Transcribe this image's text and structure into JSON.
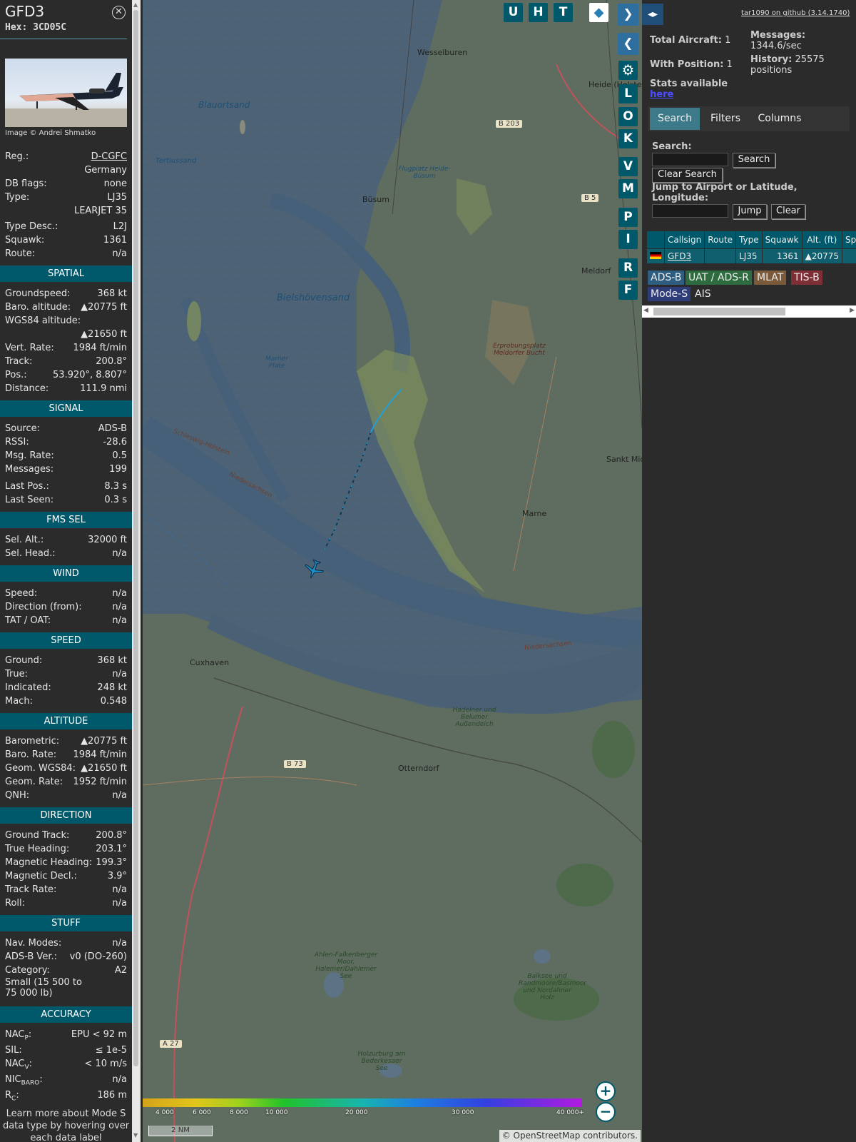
{
  "aircraft": {
    "callsign": "GFD3",
    "hex": "Hex: 3CD05C",
    "photo_credit": "Image © Andrei Shmatko",
    "reg_label": "Reg.:",
    "reg": "D-CGFC",
    "country": "Germany",
    "dbflags_label": "DB flags:",
    "dbflags": "none",
    "type_label": "Type:",
    "type": "LJ35",
    "type_name": "LEARJET 35",
    "typedesc_label": "Type Desc.:",
    "typedesc": "L2J",
    "squawk_label": "Squawk:",
    "squawk": "1361",
    "route_label": "Route:",
    "route": "n/a"
  },
  "spatial": {
    "title": "SPATIAL",
    "gs_label": "Groundspeed:",
    "gs": "368 kt",
    "baro_label": "Baro. altitude:",
    "baro": "▲20775 ft",
    "wgs_label": "WGS84 altitude:",
    "wgs": "▲21650 ft",
    "vr_label": "Vert. Rate:",
    "vr": "1984 ft/min",
    "track_label": "Track:",
    "track": "200.8°",
    "pos_label": "Pos.:",
    "pos": "53.920°, 8.807°",
    "dist_label": "Distance:",
    "dist": "111.9 nmi"
  },
  "signal": {
    "title": "SIGNAL",
    "src_label": "Source:",
    "src": "ADS-B",
    "rssi_label": "RSSI:",
    "rssi": "-28.6",
    "rate_label": "Msg. Rate:",
    "rate": "0.5",
    "msgs_label": "Messages:",
    "msgs": "199",
    "lastpos_label": "Last Pos.:",
    "lastpos": "8.3 s",
    "lastseen_label": "Last Seen:",
    "lastseen": "0.3 s"
  },
  "fms": {
    "title": "FMS SEL",
    "alt_label": "Sel. Alt.:",
    "alt": "32000 ft",
    "head_label": "Sel. Head.:",
    "head": "n/a"
  },
  "wind": {
    "title": "WIND",
    "speed_label": "Speed:",
    "speed": "n/a",
    "dir_label": "Direction (from):",
    "dir": "n/a",
    "tat_label": "TAT / OAT:",
    "tat": "n/a"
  },
  "speed": {
    "title": "SPEED",
    "ground_label": "Ground:",
    "ground": "368 kt",
    "true_label": "True:",
    "true": "n/a",
    "ind_label": "Indicated:",
    "ind": "248 kt",
    "mach_label": "Mach:",
    "mach": "0.548"
  },
  "altitude": {
    "title": "ALTITUDE",
    "baro_label": "Barometric:",
    "baro": "▲20775 ft",
    "barorate_label": "Baro. Rate:",
    "barorate": "1984 ft/min",
    "geom_label": "Geom. WGS84:",
    "geom": "▲21650 ft",
    "geomrate_label": "Geom. Rate:",
    "geomrate": "1952 ft/min",
    "qnh_label": "QNH:",
    "qnh": "n/a"
  },
  "direction": {
    "title": "DIRECTION",
    "gt_label": "Ground Track:",
    "gt": "200.8°",
    "th_label": "True Heading:",
    "th": "203.1°",
    "mh_label": "Magnetic Heading:",
    "mh": "199.3°",
    "md_label": "Magnetic Decl.:",
    "md": "3.9°",
    "tr_label": "Track Rate:",
    "tr": "n/a",
    "roll_label": "Roll:",
    "roll": "n/a"
  },
  "stuff": {
    "title": "STUFF",
    "nav_label": "Nav. Modes:",
    "nav": "n/a",
    "adsb_label": "ADS-B Ver.:",
    "adsb": "v0 (DO-260)",
    "cat_label": "Category:",
    "cat": "A2",
    "cat_desc": "Small (15 500 to 75 000 lb)"
  },
  "accuracy": {
    "title": "ACCURACY",
    "nacp_label": "NAC",
    "nacp_sub": "P",
    "nacp": "EPU < 92 m",
    "sil_label": "SIL:",
    "sil": "≤ 1e-5",
    "nacv_label": "NAC",
    "nacv_sub": "V",
    "nacv": "< 10 m/s",
    "nicbaro_label": "NIC",
    "nicbaro_sub": "BARO",
    "nicbaro": "n/a",
    "rc_label": "R",
    "rc_sub": "C",
    "rc": "186 m"
  },
  "footer_note": "Learn more about Mode S data type by hovering over each data label",
  "map": {
    "buttons_top": [
      "U",
      "H",
      "T"
    ],
    "buttons_side": [
      "L",
      "O",
      "K",
      "V",
      "M",
      "P",
      "I",
      "R",
      "F"
    ],
    "zoom_in": "+",
    "zoom_out": "−",
    "scale": "2 NM",
    "attribution_prefix": "© ",
    "attribution_link": "OpenStreetMap",
    "attribution_suffix": " contributors.",
    "legend_labels": [
      "4 000",
      "6 000",
      "8 000",
      "10 000",
      "20 000",
      "30 000",
      "40 000+"
    ],
    "places": {
      "wesselburen": "Wesselburen",
      "heide": "Heide (Holstein)",
      "blauortsand": "Blauortsand",
      "tertiussand": "Tertiussand",
      "flugplatz": "Flugplatz Heide-Büsum",
      "busum": "Büsum",
      "meldorf": "Meldorf",
      "bielshovensand": "Bielshövensand",
      "erprobung": "Erprobungsplatz Meldorfer Bucht",
      "marner_plate": "Marner Plate",
      "sh": "Schleswig-Holstein",
      "nds": "Niedersachsen",
      "sankt": "Sankt Michaelisdonn",
      "marne": "Marne",
      "cuxhaven": "Cuxhaven",
      "otterndorf": "Otterndorf",
      "hadelner": "Hadelner und Belumer Außendeich",
      "niedersachsen2": "Niedersachsen",
      "ahlen": "Ahlen-Falkenberger Moor, Halemer/Dahlemer See",
      "balksee": "Balksee und Randmoore/Basmoor und Nordahner Holz",
      "holzurburg": "Holzurburg am Bederkesaer See",
      "b203": "B 203",
      "b5": "B 5",
      "b73": "B 73",
      "a27": "A 27"
    },
    "colors": {
      "track_high": "#1ea0d8",
      "aircraft": "#1e90c8",
      "accent": "#00596b"
    }
  },
  "sidebar": {
    "github": "tar1090 on github (3.14.1740)",
    "total_label": "Total Aircraft:",
    "total": "1",
    "withpos_label": "With Position:",
    "withpos": "1",
    "msgs_label": "Messages:",
    "msgs": "1344.6/sec",
    "hist_label": "History:",
    "hist": "25575 positions",
    "stats_label": "Stats available",
    "stats_link": "here",
    "tabs": [
      "Search",
      "Filters",
      "Columns"
    ],
    "search_label": "Search:",
    "search_btn": "Search",
    "clear_search_btn": "Clear Search",
    "jump_label": "Jump to Airport or Latitude, Longitude:",
    "jump_btn": "Jump",
    "clear_btn": "Clear",
    "table_headers": [
      "Callsign",
      "Route",
      "Type",
      "Squawk",
      "Alt. (ft)",
      "Spd"
    ],
    "table_row": {
      "callsign": "GFD3",
      "route": "",
      "type": "LJ35",
      "squawk": "1361",
      "alt": "▲20775",
      "spd": ""
    },
    "sources": [
      "ADS-B",
      "UAT / ADS-R",
      "MLAT",
      "TIS-B",
      "Mode-S",
      "AIS"
    ]
  }
}
